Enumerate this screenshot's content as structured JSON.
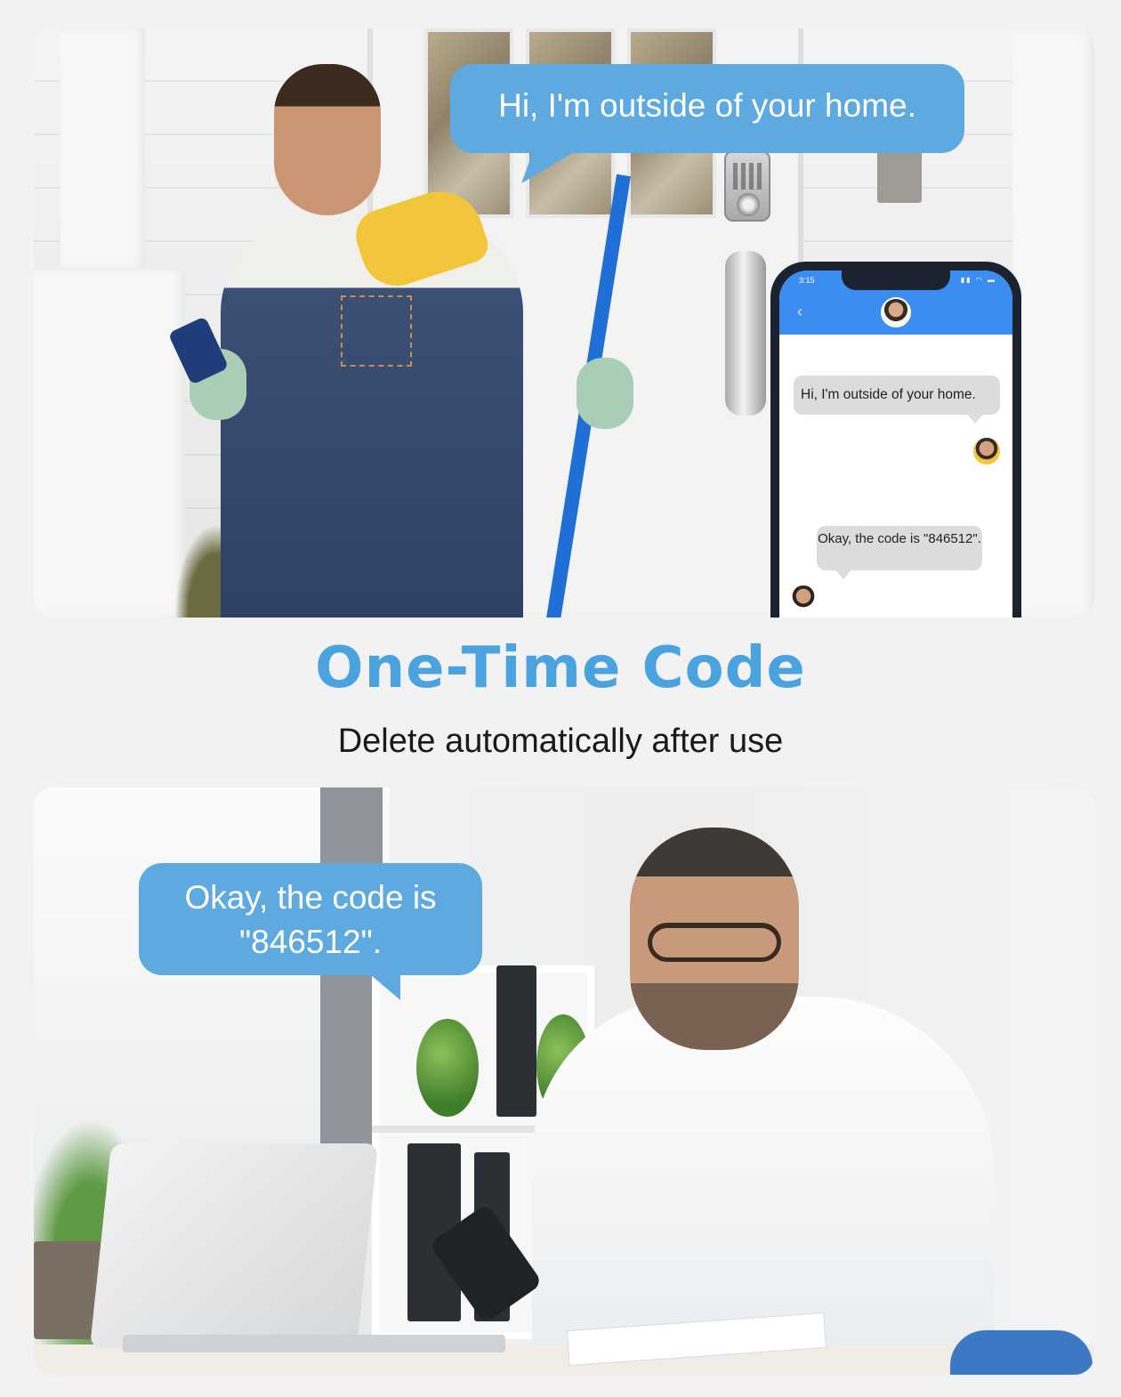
{
  "top_scene": {
    "speech_bubble": "Hi, I'm outside of your home.",
    "phone": {
      "status_time": "3:15",
      "messages": [
        "Hi, I'm outside of your home.",
        "Okay, the code is \"846512\"."
      ],
      "header_color": "#3b8df0"
    }
  },
  "headline": {
    "title": "One-Time Code",
    "subtitle": "Delete automatically after use",
    "title_color": "#4aa2df"
  },
  "bottom_scene": {
    "speech_bubble_line1": "Okay, the code is",
    "speech_bubble_line2": "\"846512\"."
  },
  "colors": {
    "bubble": "#5ea9e0",
    "background": "#f2f2f2"
  }
}
